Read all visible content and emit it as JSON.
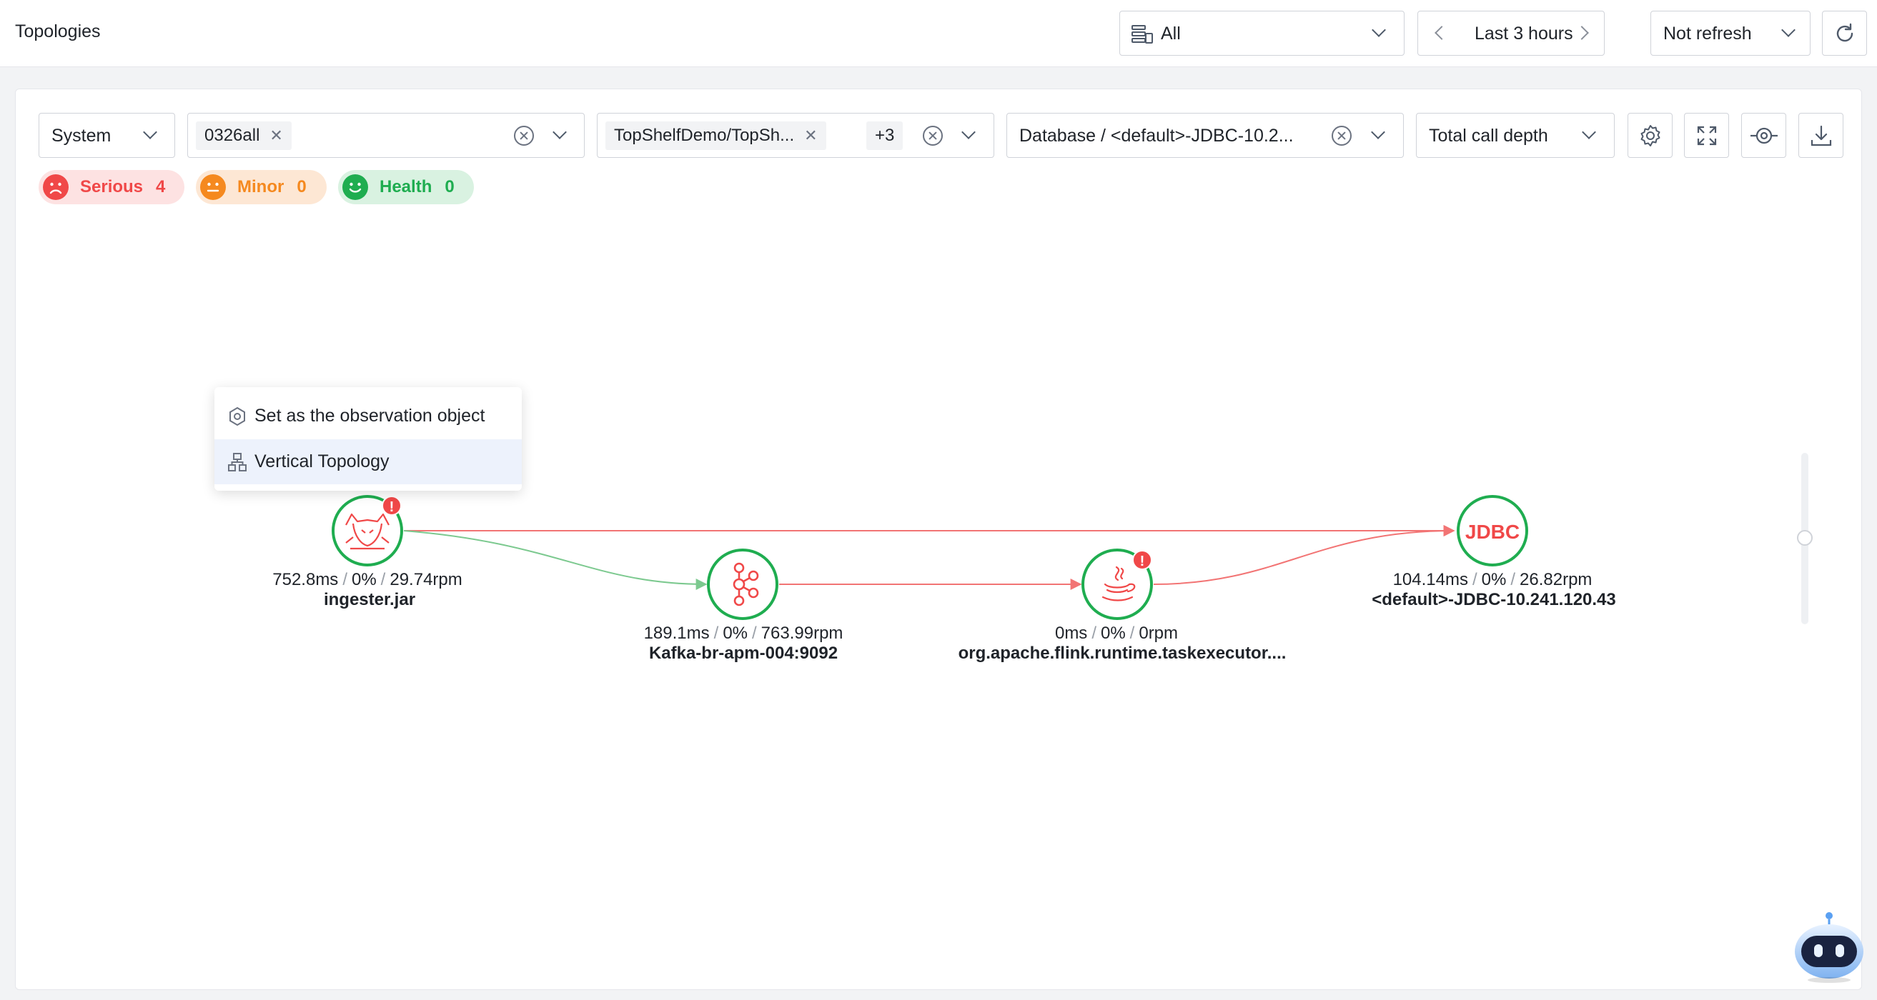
{
  "header": {
    "title": "Topologies",
    "system_select": "All",
    "time_range": "Last 3 hours",
    "refresh_select": "Not refresh"
  },
  "filters": {
    "type_select": "System",
    "system_tag": "0326all",
    "service_tag": "TopShelfDemo/TopSh...",
    "service_more": "+3",
    "database_select": "Database / <default>-JDBC-10.2...",
    "depth_select": "Total call depth"
  },
  "status_badges": [
    {
      "label": "Serious",
      "count": "4"
    },
    {
      "label": "Minor",
      "count": "0"
    },
    {
      "label": "Health",
      "count": "0"
    }
  ],
  "context_menu": {
    "items": [
      {
        "label": "Set as the observation object"
      },
      {
        "label": "Vertical Topology"
      }
    ]
  },
  "nodes": [
    {
      "name": "ingester.jar",
      "latency": "752.8ms",
      "error_rate": "0%",
      "throughput": "29.74rpm",
      "icon": "tomcat-icon",
      "alert": true
    },
    {
      "name": "Kafka-br-apm-004:9092",
      "latency": "189.1ms",
      "error_rate": "0%",
      "throughput": "763.99rpm",
      "icon": "kafka-icon",
      "alert": false
    },
    {
      "name": "org.apache.flink.runtime.taskexecutor....",
      "latency": "0ms",
      "error_rate": "0%",
      "throughput": "0rpm",
      "icon": "java-icon",
      "alert": true
    },
    {
      "name": "<default>-JDBC-10.241.120.43",
      "latency": "104.14ms",
      "error_rate": "0%",
      "throughput": "26.82rpm",
      "icon": "jdbc-icon",
      "alert": false,
      "icon_text": "JDBC"
    }
  ],
  "colors": {
    "serious": "#f04848",
    "minor": "#f5891f",
    "health": "#1fad50",
    "node_ring": "#1fad50",
    "edge_error": "#f27474",
    "edge_ok": "#7cc98f"
  }
}
